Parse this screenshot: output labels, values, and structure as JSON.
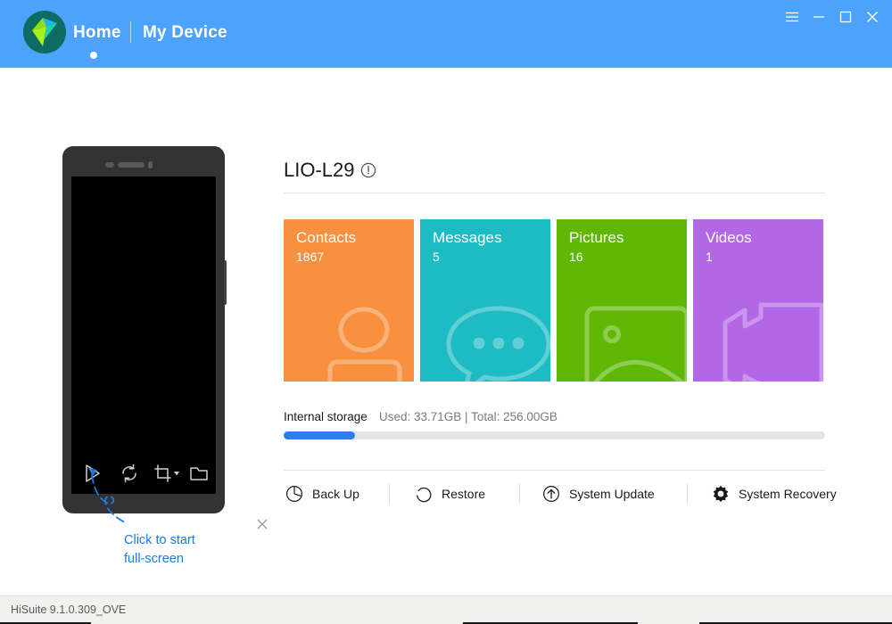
{
  "window": {
    "controls": [
      {
        "name": "menu-button",
        "label": "Menu"
      },
      {
        "name": "minimize-button",
        "label": "Minimize"
      },
      {
        "name": "maximize-button",
        "label": "Maximize"
      },
      {
        "name": "close-button",
        "label": "Close"
      }
    ]
  },
  "nav": {
    "home_label": "Home",
    "device_label": "My Device",
    "active": "Home"
  },
  "phone": {
    "toolbar": [
      {
        "name": "play-icon",
        "label": "Start full-screen"
      },
      {
        "name": "refresh-icon",
        "label": "Refresh"
      },
      {
        "name": "crop-icon",
        "label": "Screenshot"
      },
      {
        "name": "folder-icon",
        "label": "Open folder"
      }
    ]
  },
  "annotation": {
    "line1": "Click to start",
    "line2": "full-screen",
    "color": "#1f7ae0"
  },
  "device": {
    "model": "LIO-L29"
  },
  "tiles": [
    {
      "label": "Contacts",
      "count": "1867",
      "color": "#f7913f",
      "art": "contacts-art"
    },
    {
      "label": "Messages",
      "count": "5",
      "color": "#1dbcc4",
      "art": "messages-art"
    },
    {
      "label": "Pictures",
      "count": "16",
      "color": "#5fb806",
      "art": "pictures-art"
    },
    {
      "label": "Videos",
      "count": "1",
      "color": "#b267e6",
      "art": "videos-art"
    }
  ],
  "storage": {
    "label": "Internal storage",
    "detail": "Used: 33.71GB | Total: 256.00GB",
    "used_gb": 33.71,
    "total_gb": 256.0,
    "percent": 13.2,
    "fill_color": "#2f7ef0",
    "track_color": "#e4e4e4"
  },
  "actions": [
    {
      "label": "Back Up",
      "icon": "backup-icon"
    },
    {
      "label": "Restore",
      "icon": "restore-icon"
    },
    {
      "label": "System Update",
      "icon": "system-update-icon"
    },
    {
      "label": "System Recovery",
      "icon": "system-recovery-icon"
    }
  ],
  "status": {
    "version": "HiSuite 9.1.0.309_OVE"
  },
  "theme": {
    "header": "#4da2fb",
    "accent": "#2f7ef0",
    "phone_body": "#333334"
  }
}
